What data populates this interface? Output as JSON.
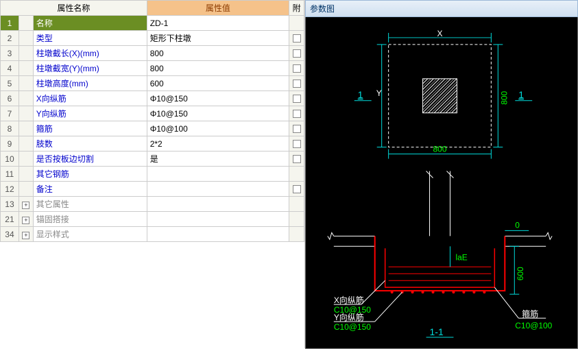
{
  "headers": {
    "name": "属性名称",
    "value": "属性值",
    "attach": "附"
  },
  "rows": [
    {
      "num": "1",
      "name": "名称",
      "value": "ZD-1",
      "attach": false,
      "selected": true
    },
    {
      "num": "2",
      "name": "类型",
      "value": "矩形下柱墩",
      "attach": true
    },
    {
      "num": "3",
      "name": "柱墩截长(X)(mm)",
      "value": "800",
      "attach": true
    },
    {
      "num": "4",
      "name": "柱墩截宽(Y)(mm)",
      "value": "800",
      "attach": true
    },
    {
      "num": "5",
      "name": "柱墩高度(mm)",
      "value": "600",
      "attach": true
    },
    {
      "num": "6",
      "name": "X向纵筋",
      "value": "Φ10@150",
      "attach": true
    },
    {
      "num": "7",
      "name": "Y向纵筋",
      "value": "Φ10@150",
      "attach": true
    },
    {
      "num": "8",
      "name": "箍筋",
      "value": "Φ10@100",
      "attach": true
    },
    {
      "num": "9",
      "name": "肢数",
      "value": "2*2",
      "attach": true
    },
    {
      "num": "10",
      "name": "是否按板边切割",
      "value": "是",
      "attach": true
    },
    {
      "num": "11",
      "name": "其它钢筋",
      "value": "",
      "attach": false
    },
    {
      "num": "12",
      "name": "备注",
      "value": "",
      "attach": true
    }
  ],
  "groupRows": [
    {
      "num": "13",
      "name": "其它属性"
    },
    {
      "num": "21",
      "name": "锚固搭接"
    },
    {
      "num": "34",
      "name": "显示样式"
    }
  ],
  "rightPanel": {
    "title": "参数图",
    "labels": {
      "X": "X",
      "Y": "Y",
      "one": "1",
      "oneR": "1",
      "dim800": "800",
      "dim800v": "800",
      "laE": "laE",
      "zero": "0",
      "dim600": "600",
      "xRebar": "X向纵筋",
      "xRebarVal": "C10@150",
      "yRebar": "Y向纵筋",
      "yRebarVal": "C10@150",
      "stirrup": "箍筋",
      "stirrupVal": "C10@100",
      "section": "1-1"
    }
  }
}
